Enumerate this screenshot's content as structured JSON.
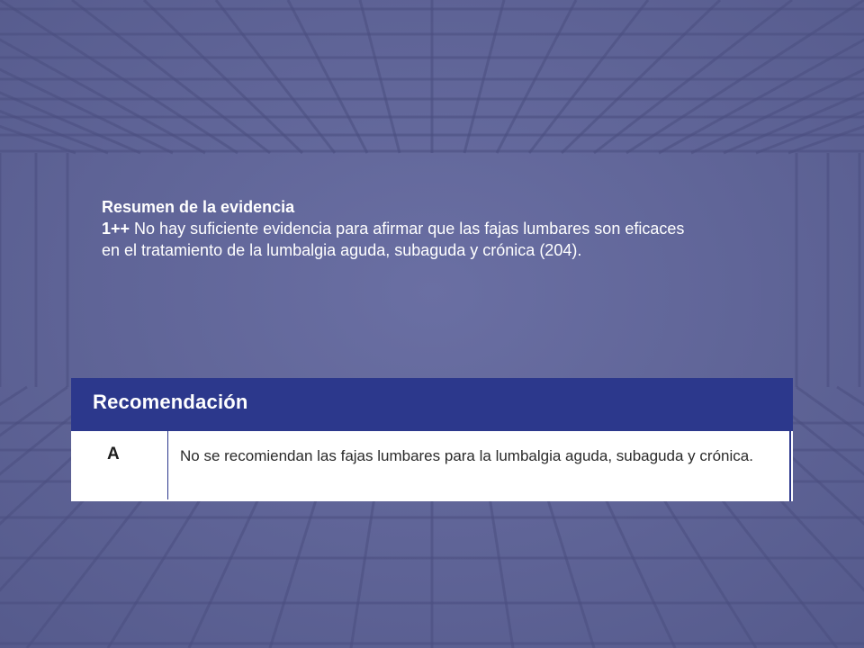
{
  "slide": {
    "background_color": "#5f6496",
    "heading": "Resumen de la evidencia",
    "evidence_level": "1++",
    "evidence_line1": " No hay suficiente evidencia para afirmar que las fajas lumbares son eficaces",
    "evidence_line2": "en el tratamiento de la lumbalgia aguda, subaguda y crónica (204)."
  },
  "recommendation": {
    "title": "Recomendación",
    "header_color": "#2c388c",
    "grade": "A",
    "text": "No se recomiendan las fajas lumbares para la lumbalgia aguda, subaguda y crónica."
  }
}
